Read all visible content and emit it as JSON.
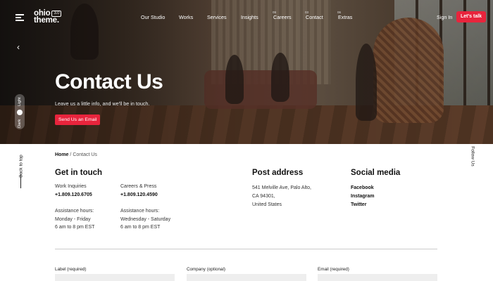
{
  "brand": {
    "logo_line1": "ohio",
    "logo_line2": "theme.",
    "badge": "3.0"
  },
  "nav": [
    {
      "label": "Our Studio",
      "badge": ""
    },
    {
      "label": "Works",
      "badge": ""
    },
    {
      "label": "Services",
      "badge": ""
    },
    {
      "label": "Insights",
      "badge": "09"
    },
    {
      "label": "Careers",
      "badge": "03"
    },
    {
      "label": "Contact",
      "badge": "06"
    },
    {
      "label": "Extras",
      "badge": ""
    }
  ],
  "header": {
    "signin": "Sign In",
    "cta": "Let's talk"
  },
  "hero": {
    "title": "Contact Us",
    "subtitle": "Leave us a little info, and we'll be in touch.",
    "button": "Send Us an Email",
    "mode_dark": "Dark",
    "mode_light": "Light"
  },
  "side": {
    "back_to_top": "Back to top",
    "follow_us": "Follow Us"
  },
  "breadcrumb": {
    "home": "Home",
    "separator": "/",
    "current": "Contact Us"
  },
  "contact": {
    "heading": "Get in touch",
    "col1": {
      "label": "Work Inquiries",
      "phone": "+1.809.120.6705",
      "hours_label": "Assistance hours:",
      "days": "Monday - Friday",
      "time": "6 am to 8 pm EST"
    },
    "col2": {
      "label": "Careers & Press",
      "phone": "+1.809.120.4590",
      "hours_label": "Assistance hours:",
      "days": "Wednesday - Saturday",
      "time": "6 am to 8 pm EST"
    }
  },
  "address": {
    "heading": "Post address",
    "line1": "541 Melville Ave, Palo Alto,",
    "line2": "CA 94301,",
    "line3": "United States"
  },
  "social": {
    "heading": "Social media",
    "links": [
      "Facebook",
      "Instagram",
      "Twitter"
    ]
  },
  "form": {
    "fields": [
      {
        "label": "Label (required)",
        "placeholder": ""
      },
      {
        "label": "Company (optional)",
        "placeholder": ""
      },
      {
        "label": "Email (required)",
        "placeholder": ""
      }
    ]
  },
  "colors": {
    "accent": "#e8243c"
  }
}
